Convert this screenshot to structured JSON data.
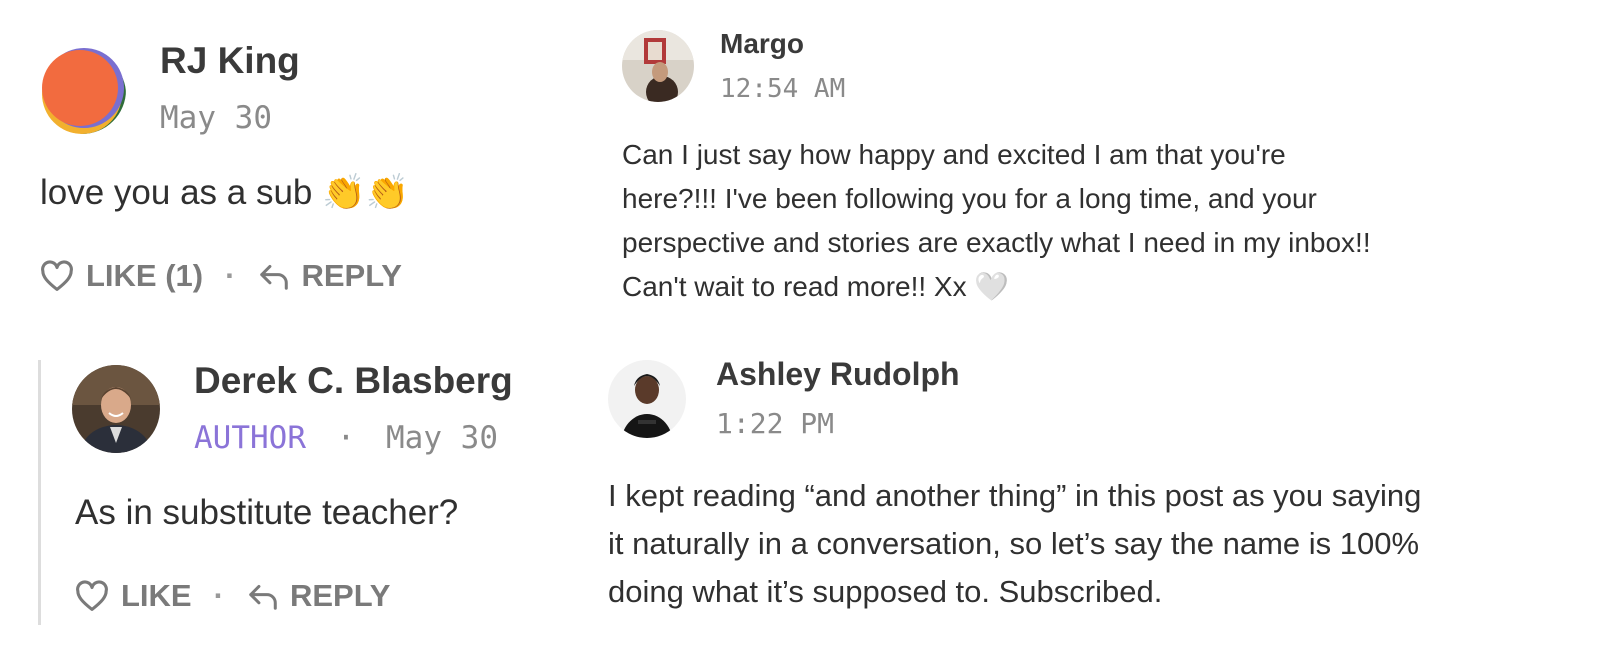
{
  "comments": {
    "rj_king": {
      "name": "RJ King",
      "date": "May 30",
      "text": "love you as a sub 👏👏",
      "like_label": "LIKE (1)",
      "dot": "·",
      "reply_label": "REPLY"
    },
    "derek": {
      "name": "Derek C. Blasberg",
      "tag": "AUTHOR",
      "dot": "·",
      "date": "May 30",
      "text": "As in substitute teacher?",
      "like_label": "LIKE",
      "reply_label": "REPLY"
    },
    "margo": {
      "name": "Margo",
      "time": "12:54 AM",
      "text_lines": [
        "Can I just say how happy and excited I am that you're",
        "here?!!! I've been following you for a long time, and your",
        "perspective and stories are exactly what I need in my inbox!!",
        "Can't wait to read more!! Xx 🤍"
      ]
    },
    "ashley": {
      "name": "Ashley Rudolph",
      "time": "1:22 PM",
      "text_lines": [
        "I kept reading “and another thing” in this post as you saying",
        "it naturally in a conversation, so let’s say the name is 100%",
        "doing what it’s supposed to. Subscribed."
      ]
    }
  },
  "colors": {
    "author_tag": "#8b74d8",
    "meta": "#8a8a8a",
    "action": "#7a7a7a",
    "thread_line": "#dddddd"
  },
  "icons": {
    "like": "heart-outline-icon",
    "reply": "reply-arrow-icon"
  }
}
